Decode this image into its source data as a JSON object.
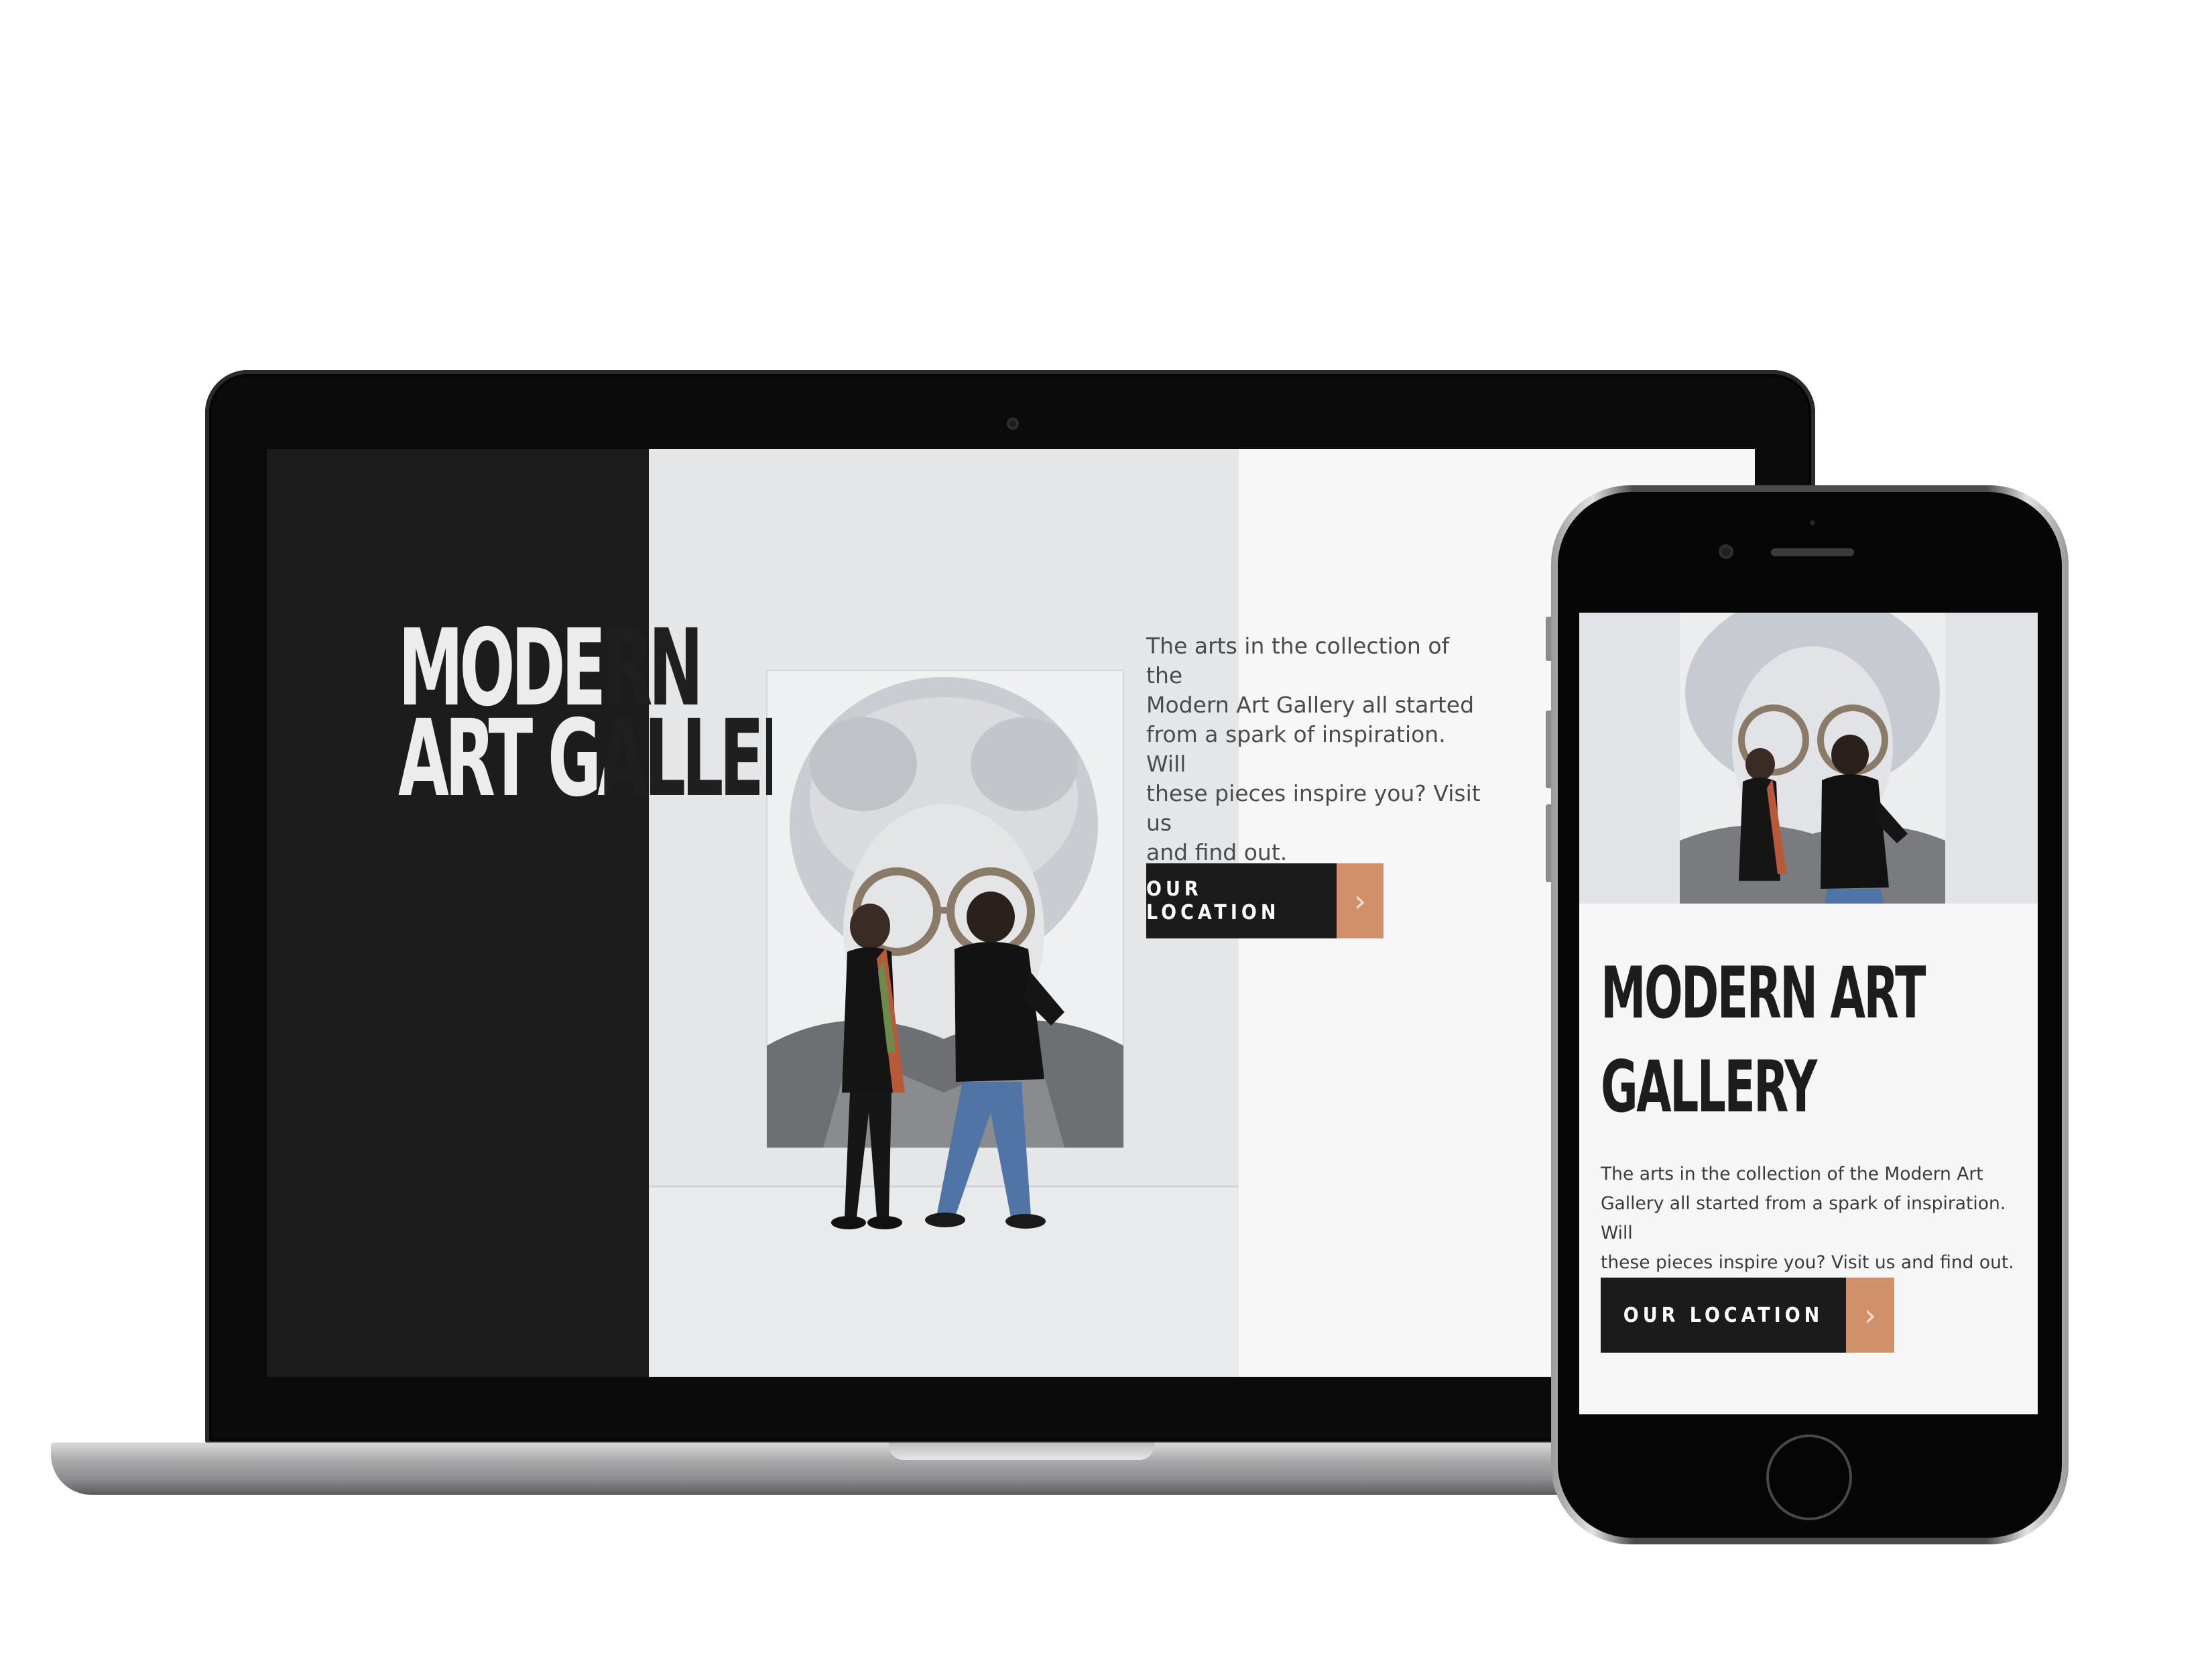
{
  "site": {
    "title_line1": "MODERN",
    "title_line2": "ART GALLERY",
    "mobile_title_line1": "MODERN ART",
    "mobile_title_line2": "GALLERY",
    "description_desktop_lines": [
      "The arts in the collection of the",
      "Modern Art Gallery all started",
      "from a spark of inspiration. Will",
      "these pieces inspire you? Visit us",
      "and find out."
    ],
    "description_mobile_lines": [
      "The arts in the collection of the Modern Art",
      "Gallery all started from a spark of inspiration. Will",
      "these pieces inspire you? Visit us and find out."
    ],
    "cta_label": "OUR LOCATION",
    "cta_icon": "chevron-right-icon",
    "cta_arrow_glyph": "›"
  },
  "colors": {
    "dark_panel": "#1c1c1c",
    "accent": "#d0916a",
    "button": "#1b1b1b",
    "page_bg": "#f7f7f7"
  }
}
